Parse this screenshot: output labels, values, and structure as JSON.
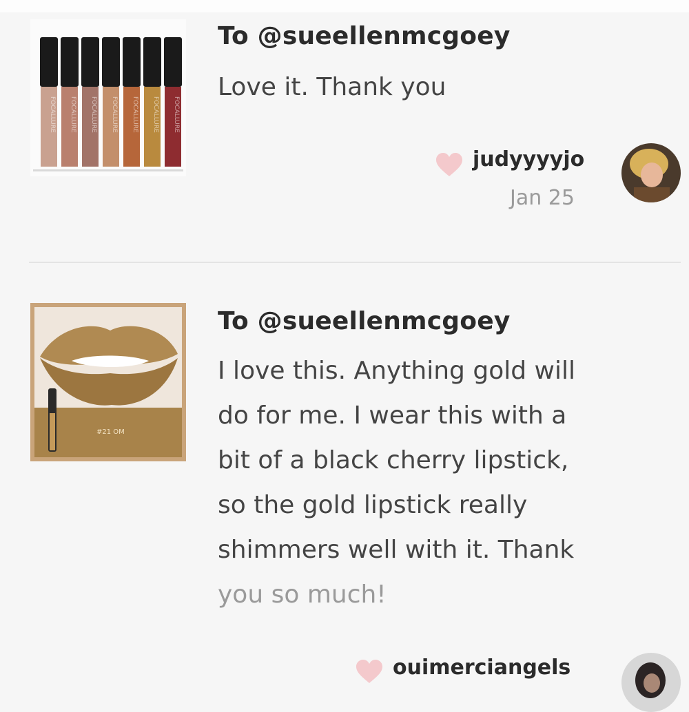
{
  "comments": [
    {
      "to": "To @sueellenmcgoey",
      "lines": [
        "Love it. Thank you"
      ],
      "username": "judyyyyjo",
      "date": "Jan 25",
      "thumbnail": "lip-gloss-set-image",
      "brand_text": "FOCALLURE"
    },
    {
      "to": "To @sueellenmcgoey",
      "lines": [
        "I love this. Anything gold will",
        "do for me. I wear this with a",
        "bit of a black cherry lipstick,",
        "so the gold lipstick really",
        "shimmers well with it. Thank",
        "you so much!"
      ],
      "username": "ouimerciangels",
      "thumbnail": "gold-lipstick-image",
      "shade_label": "#21 OM"
    }
  ],
  "colors": {
    "background": "#f6f6f6",
    "heart": "#f4c9cc",
    "divider": "#e4e4e4",
    "text_primary": "#2b2b2b",
    "text_secondary": "#9a9a9a"
  },
  "icons": [
    "heart-icon",
    "avatar"
  ]
}
